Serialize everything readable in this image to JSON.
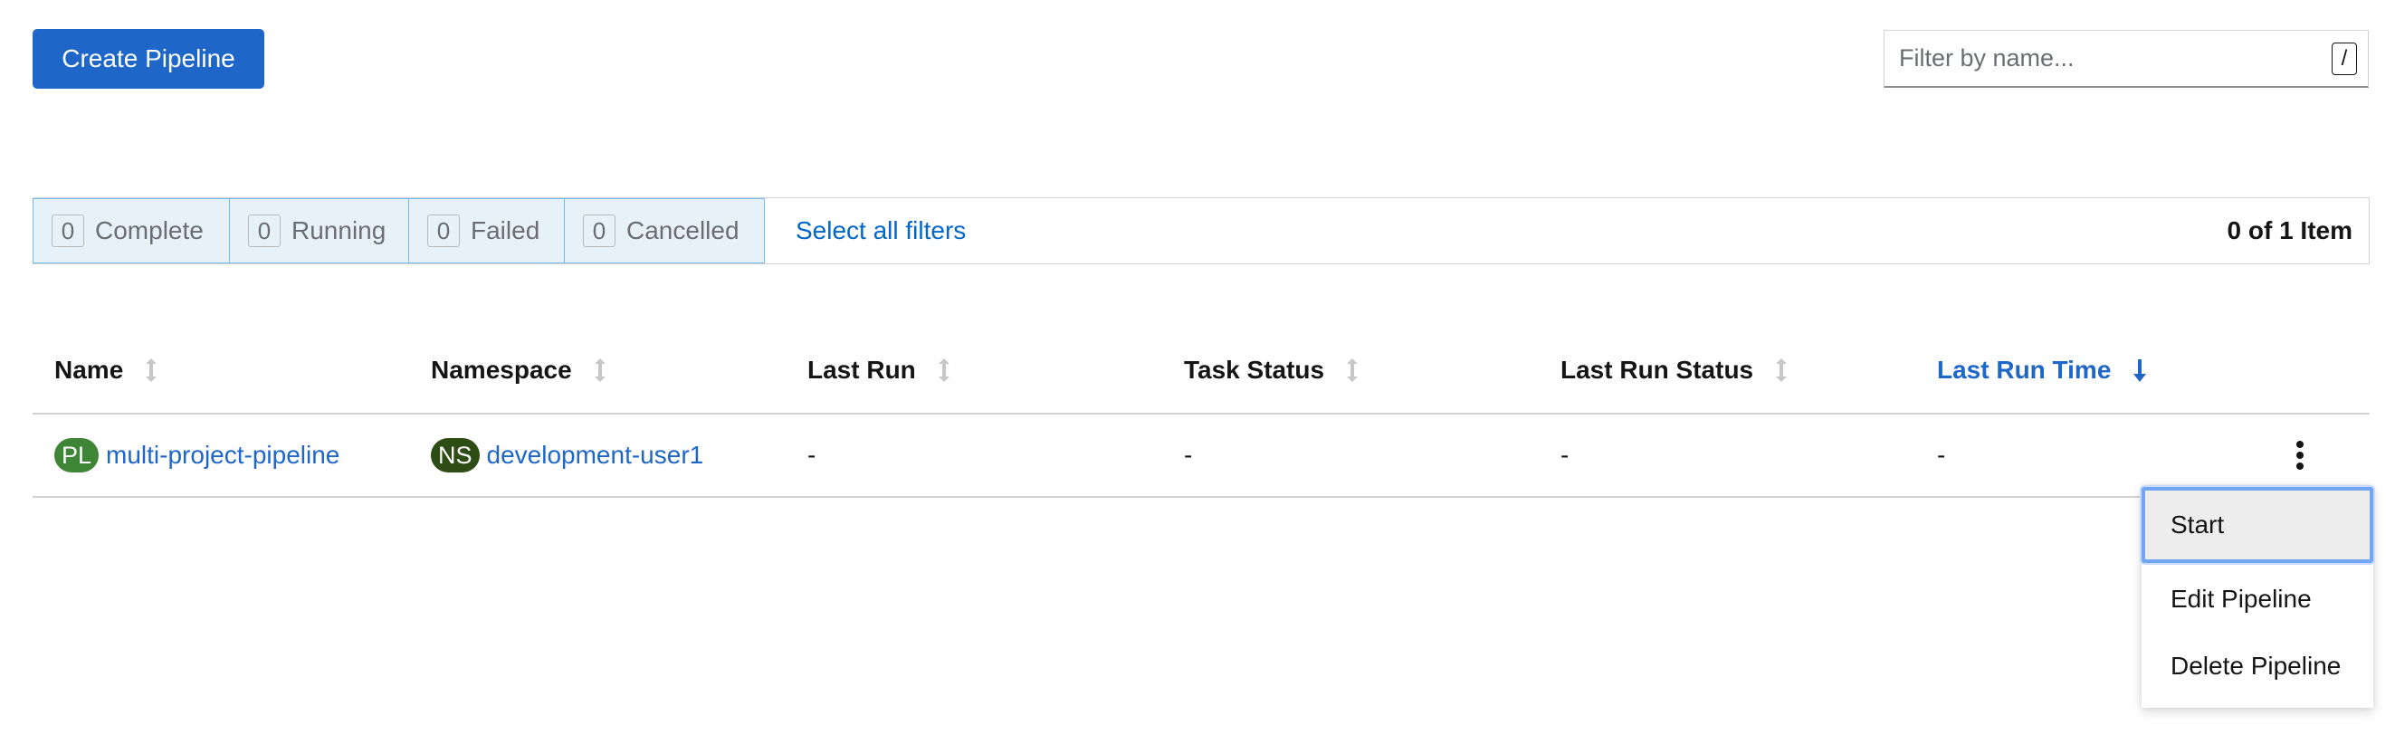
{
  "toolbar": {
    "create_label": "Create Pipeline",
    "filter_placeholder": "Filter by name...",
    "filter_shortcut": "/"
  },
  "status_filters": [
    {
      "count": "0",
      "label": "Complete"
    },
    {
      "count": "0",
      "label": "Running"
    },
    {
      "count": "0",
      "label": "Failed"
    },
    {
      "count": "0",
      "label": "Cancelled"
    }
  ],
  "select_all_label": "Select all filters",
  "item_count": "0 of 1 Item",
  "columns": {
    "name": "Name",
    "namespace": "Namespace",
    "last_run": "Last Run",
    "task_status": "Task Status",
    "last_run_status": "Last Run Status",
    "last_run_time": "Last Run Time"
  },
  "rows": [
    {
      "name_badge": "PL",
      "name": "multi-project-pipeline",
      "namespace_badge": "NS",
      "namespace": "development-user1",
      "last_run": "-",
      "task_status": "-",
      "last_run_status": "-",
      "last_run_time": "-"
    }
  ],
  "actions_menu": {
    "items": [
      "Start",
      "Edit Pipeline",
      "Delete Pipeline"
    ]
  },
  "colors": {
    "primary": "#1e66c8",
    "pipeline_badge": "#3e8635",
    "namespace_badge": "#2d4d14",
    "filter_bg": "#e7f1fa"
  },
  "icons": {
    "sort": "sort-icon",
    "sort_active": "sort-down-arrow-icon",
    "kebab": "kebab-icon"
  }
}
